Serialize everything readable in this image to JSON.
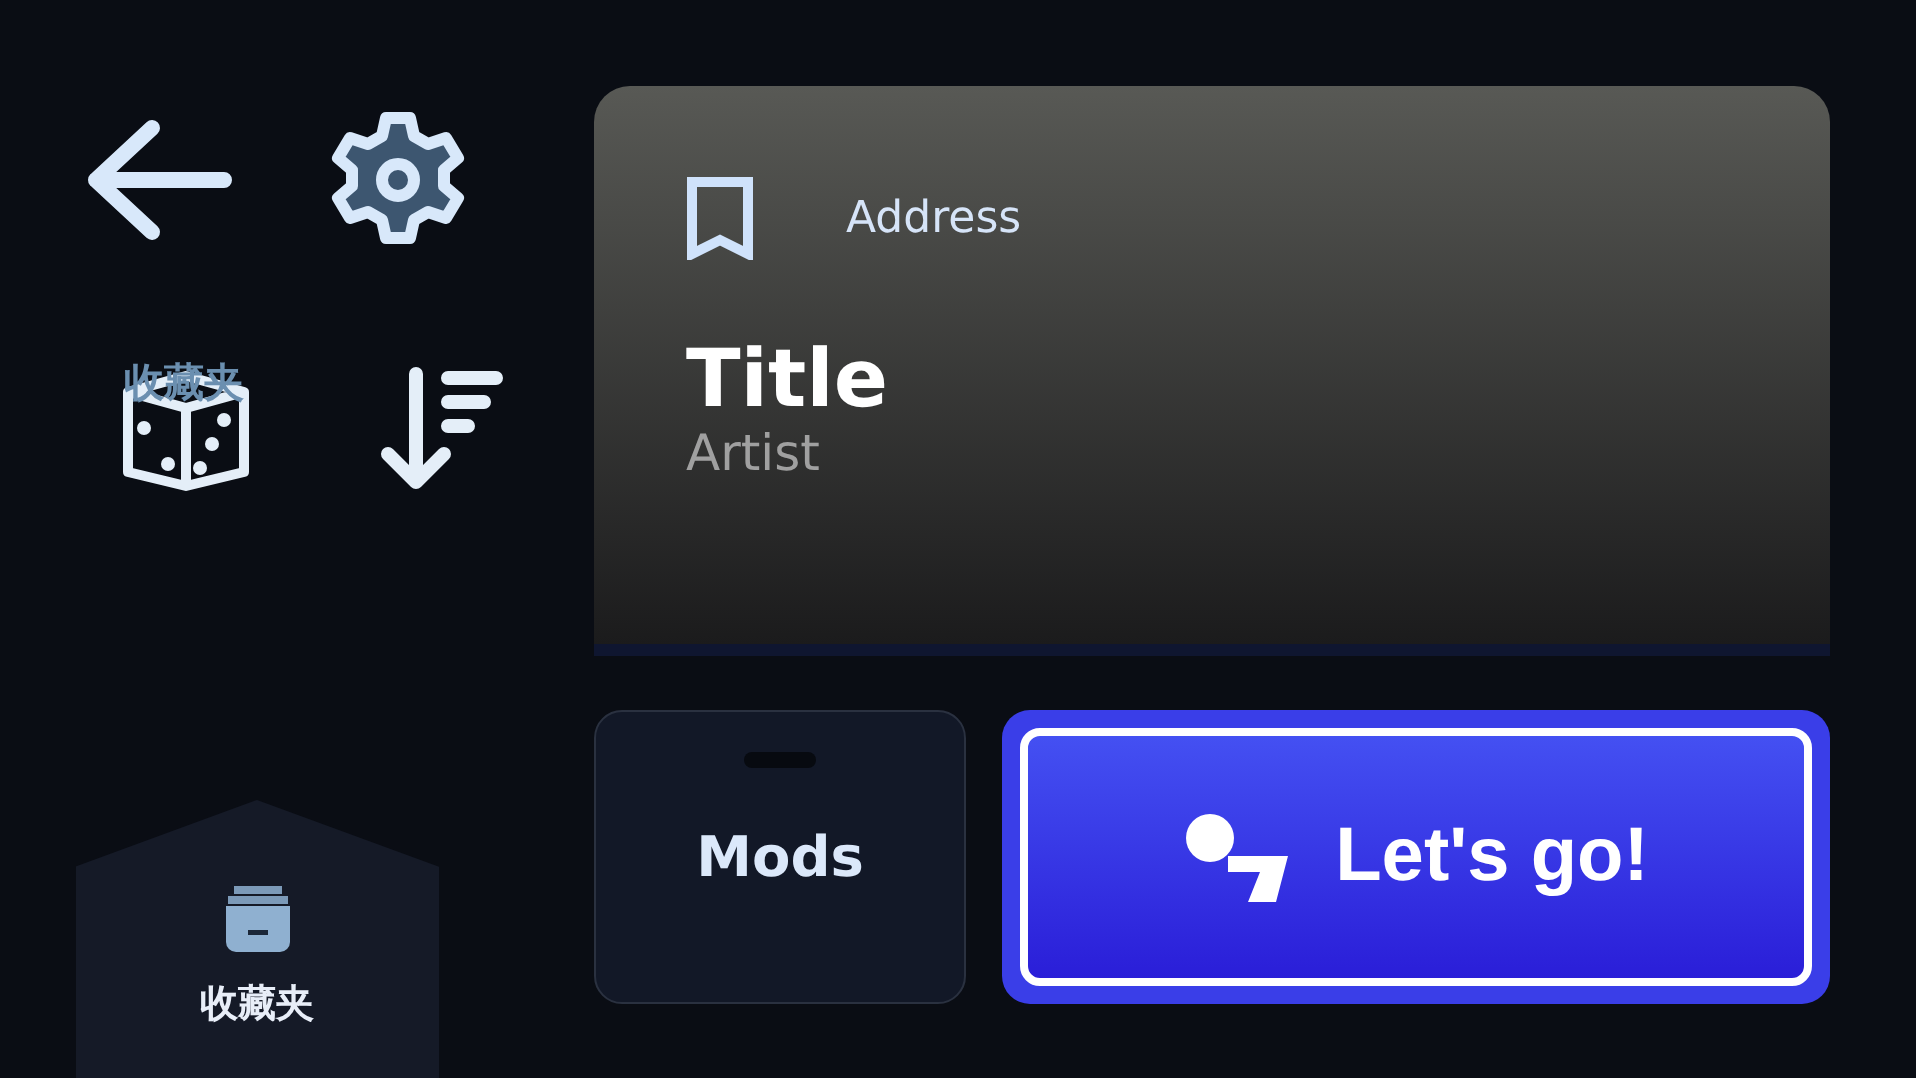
{
  "toolbar": {
    "overlay_label": "收藏夹"
  },
  "nav_tab": {
    "label": "收藏夹"
  },
  "card": {
    "address": "Address",
    "title": "Title",
    "artist": "Artist"
  },
  "buttons": {
    "mods": "Mods",
    "play": "Let's go!"
  }
}
